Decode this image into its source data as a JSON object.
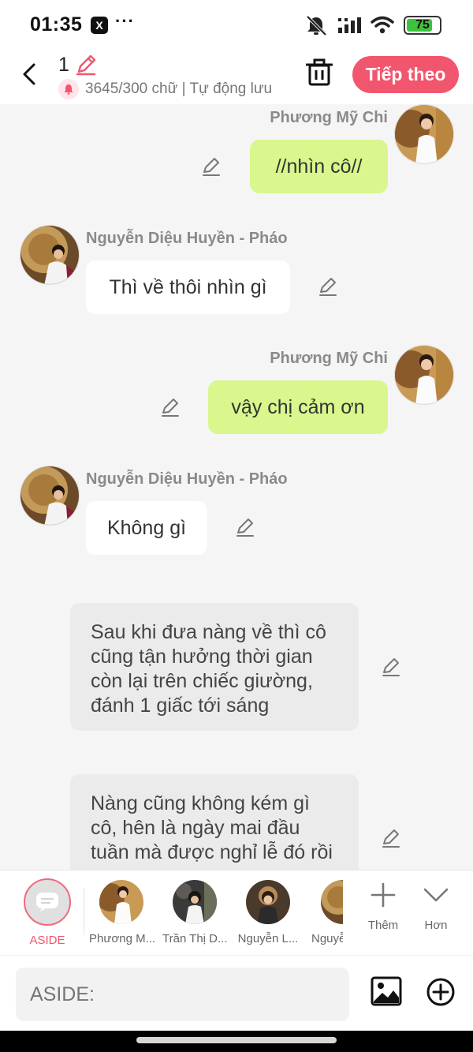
{
  "status": {
    "time": "01:35",
    "battery": "75",
    "x_badge": "X",
    "dots": "···"
  },
  "header": {
    "chapter_number": "1",
    "word_count": "3645/300 chữ | Tự động lưu",
    "next_label": "Tiếp theo"
  },
  "messages": [
    {
      "speaker": "Phương Mỹ Chi",
      "text": "//nhìn cô//"
    },
    {
      "speaker": "Nguyễn Diệu Huyền - Pháo",
      "text": "Thì về thôi nhìn gì"
    },
    {
      "speaker": "Phương Mỹ Chi",
      "text": "vậy chị cảm ơn"
    },
    {
      "speaker": "Nguyễn Diệu Huyền - Pháo",
      "text": "Không gì"
    }
  ],
  "narrations": [
    "Sau khi đưa nàng về thì cô cũng tận hưởng thời gian còn lại trên chiếc giường, đánh 1 giấc tới sáng",
    "Nàng cũng không kém gì cô, hên là ngày mai đầu tuần mà được nghỉ lễ đó rồi"
  ],
  "characters": {
    "aside_label": "ASIDE",
    "list": [
      "Phương M...",
      "Trần Thị D...",
      "Nguyễn L...",
      "Nguyễ"
    ],
    "add_label": "Thêm",
    "more_label": "Hơn"
  },
  "input": {
    "placeholder": "ASIDE:"
  },
  "colors": {
    "accent": "#f2566e",
    "my_bubble": "#d9f78d",
    "background": "#f5f5f5"
  },
  "icons": [
    "back-icon",
    "pencil-icon",
    "trash-icon",
    "image-icon",
    "plus-circle-icon",
    "chevron-down-icon",
    "plus-icon",
    "chat-bubble-icon"
  ]
}
